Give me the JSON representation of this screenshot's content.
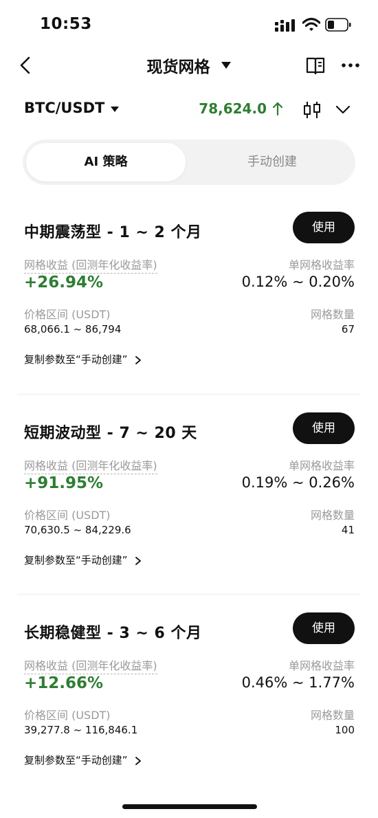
{
  "status_bar": {
    "time": "10:53"
  },
  "header": {
    "title": "现货网格"
  },
  "pair": {
    "name": "BTC/USDT",
    "price": "78,624.0",
    "price_color": "#2e7d32"
  },
  "tabs": [
    {
      "label": "AI 策略",
      "active": true
    },
    {
      "label": "手动创建",
      "active": false
    }
  ],
  "labels": {
    "yield": "网格收益 (回测年化收益率)",
    "per_grid": "单网格收益率",
    "range": "价格区间 (USDT)",
    "count": "网格数量",
    "copy": "复制参数至“手动创建”",
    "use_button": "使用"
  },
  "strategies": [
    {
      "title": "中期震荡型 - 1 ~ 2 个月",
      "yield": "+26.94%",
      "per_grid": "0.12% ~ 0.20%",
      "range": "68,066.1 ~ 86,794",
      "count": "67"
    },
    {
      "title": "短期波动型 - 7 ~ 20 天",
      "yield": "+91.95%",
      "per_grid": "0.19% ~ 0.26%",
      "range": "70,630.5 ~ 84,229.6",
      "count": "41"
    },
    {
      "title": "长期稳健型 - 3 ~ 6 个月",
      "yield": "+12.66%",
      "per_grid": "0.46% ~ 1.77%",
      "range": "39,277.8 ~ 116,846.1",
      "count": "100"
    }
  ],
  "colors": {
    "positive": "#2e7d32",
    "button_bg": "#111111",
    "tab_bg": "#f2f2f2"
  }
}
